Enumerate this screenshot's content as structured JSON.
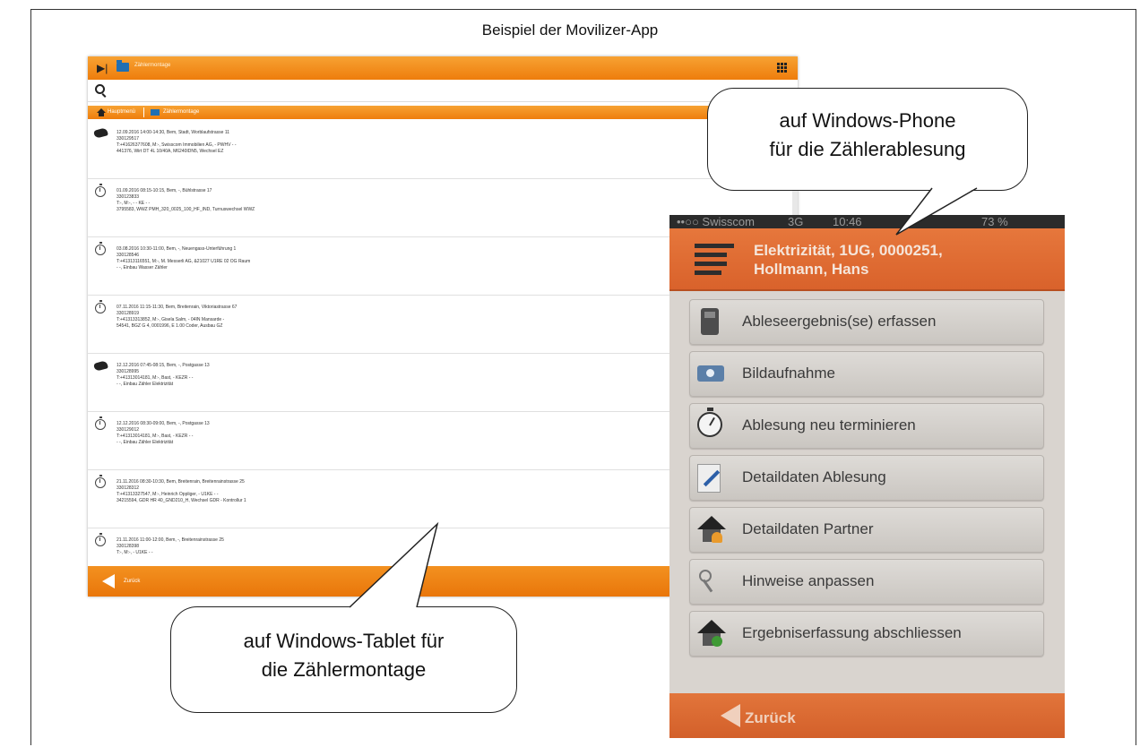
{
  "figure_title": "Beispiel der Movilizer-App",
  "tablet": {
    "header_title": "Zählermontage",
    "search_placeholder": "",
    "breadcrumb": {
      "home": "Hauptmenü",
      "current": "Zählermontage"
    },
    "rows": [
      {
        "icon": "handshake-icon",
        "lines": [
          "12.09.2016 14:00-14:30, Bem, Stadt, Worblaufstrasse 11",
          "330129517",
          "T:+41626377608, M:-, Swisscom Immobilien AG, - PWHV - -",
          "441376, Wirt DT 4L 10/40A, M6240IDN5, Wechsel EZ"
        ]
      },
      {
        "icon": "clock-icon",
        "lines": [
          "01.09.2016 08:15-10:15, Bem, -, Bühlstrasse 17",
          "330123833",
          "T:-, M:-, - - KE - -",
          "3795583, WWZ PMH_320_0025_100_HF_IND, Turnuswechsel WWZ"
        ]
      },
      {
        "icon": "clock-icon",
        "lines": [
          "03.08.2016 10:30-11:00, Bem, -, Neuengass-Unterführung 1",
          "330128546",
          "T:+41313116551, M:-, M. Messerli AG, &21027 U1RE 02 OG Raum",
          "- -, Einbau Wasser Zähler"
        ]
      },
      {
        "icon": "clock-icon",
        "lines": [
          "07.11.2016 11:15-11:30, Bem, Breitenrain, Viktoriastrasse 67",
          "330128919",
          "T:+41313313852, M:-, Gisela Salm, - 04IN Mansarde -",
          "54541, BGZ G 4, 0001996, E 1.00 Coder, Ausbau GZ"
        ]
      },
      {
        "icon": "handshake-icon",
        "lines": [
          "12.12.2016 07:45-08:15, Bem, -, Postgasse 13",
          "330128995",
          "T:+41313014181, M:-, Bast, - KEZR - -",
          "- -, Einbau Zähler Elektrizität"
        ]
      },
      {
        "icon": "clock-icon",
        "lines": [
          "12.12.2016 08:30-09:00, Bem, -, Postgasse 13",
          "330129012",
          "T:+41313014181, M:-, Bast, - KEZR - -",
          "- -, Einbau Zähler Elektrizität"
        ]
      },
      {
        "icon": "clock-icon",
        "lines": [
          "21.11.2016 08:30-10:30, Bem, Breitenrain, Breitenrainstrasse 25",
          "330128312",
          "T:+41313327547, M:-, Heinrich Oppliger, - U1KE - -",
          "34215594, GDR HR 40_GND210_H, Wechsel GDR - Kontrollur 1"
        ]
      },
      {
        "icon": "clock-icon",
        "lines": [
          "21.11.2016 11:00-12:00, Bem, -, Breitenrainstrasse 25",
          "330128398",
          "T:-, M:-, - U1KE - -",
          ""
        ]
      }
    ],
    "back_label": "Zurück"
  },
  "phone": {
    "status": {
      "carrier": "••○○ Swisscom",
      "network": "3G",
      "time": "10:46",
      "battery": "73 %"
    },
    "header_title_line1": "Elektrizität, 1UG, 0000251,",
    "header_title_line2": "Hollmann, Hans",
    "menu": [
      {
        "label": "Ableseergebnis(se) erfassen",
        "icon": "meter-device-icon"
      },
      {
        "label": "Bildaufnahme",
        "icon": "camera-icon"
      },
      {
        "label": "Ablesung neu terminieren",
        "icon": "stopwatch-icon"
      },
      {
        "label": "Detaildaten Ablesung",
        "icon": "pen-icon"
      },
      {
        "label": "Detaildaten Partner",
        "icon": "house-person-icon"
      },
      {
        "label": "Hinweise anpassen",
        "icon": "keys-icon"
      },
      {
        "label": "Ergebniserfassung abschliessen",
        "icon": "house-check-icon"
      }
    ],
    "back_label": "Zurück"
  },
  "callouts": {
    "phone_line1": "auf Windows-Phone",
    "phone_line2": "für die Zählerablesung",
    "tablet_line1": "auf Windows-Tablet  für",
    "tablet_line2": "die Zählermontage"
  }
}
